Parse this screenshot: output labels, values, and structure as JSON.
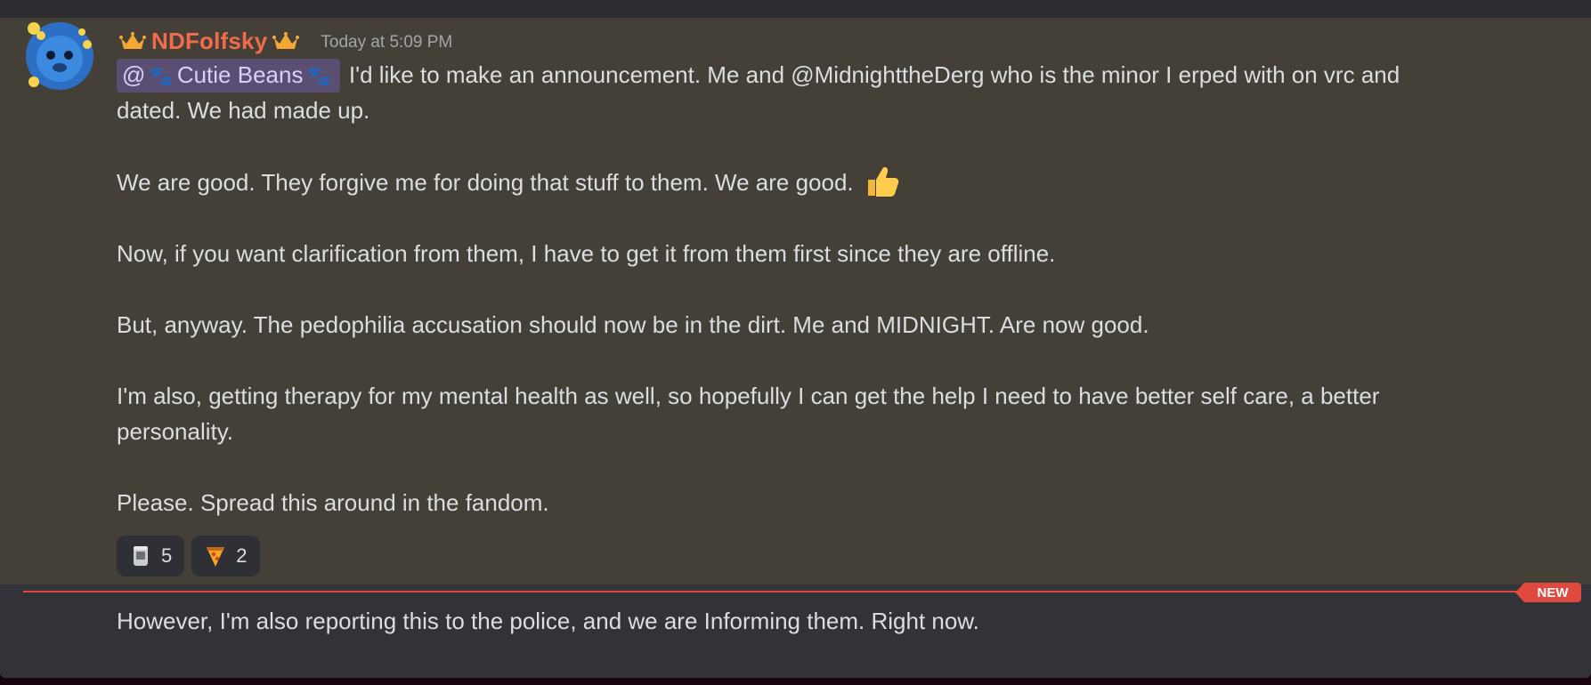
{
  "message": {
    "username": "NDFolfsky",
    "timestamp": "Today at 5:09 PM",
    "mention": {
      "at": "@",
      "name": "Cutie Beans"
    },
    "line1_rest": "I'd like to make an announcement. Me and @MidnighttheDerg who is the minor I erped with on vrc and",
    "line2": "dated. We had made up.",
    "line3": "We are good. They forgive me for doing that stuff to them. We are good.",
    "line4": "Now, if you want clarification from them, I have to get it from them first since they are offline.",
    "line5": "But, anyway. The pedophilia accusation should now be in the dirt. Me and MIDNIGHT. Are now good.",
    "line6": "I'm also, getting therapy for my mental health as well, so hopefully I can get the help I need to have better self care, a better",
    "line7": "personality.",
    "line8": "Please. Spread this around in the fandom."
  },
  "reactions": [
    {
      "icon": "cup-icon",
      "count": "5"
    },
    {
      "icon": "pizza-icon",
      "count": "2"
    }
  ],
  "divider": {
    "label": "NEW",
    "color": "#e0493d"
  },
  "followup": "However, I'm also reporting this to the police, and we are Informing them. Right now.",
  "colors": {
    "username": "#f26b4c",
    "highlight_bg": "#444037",
    "mention_bg": "#5b4e73"
  }
}
